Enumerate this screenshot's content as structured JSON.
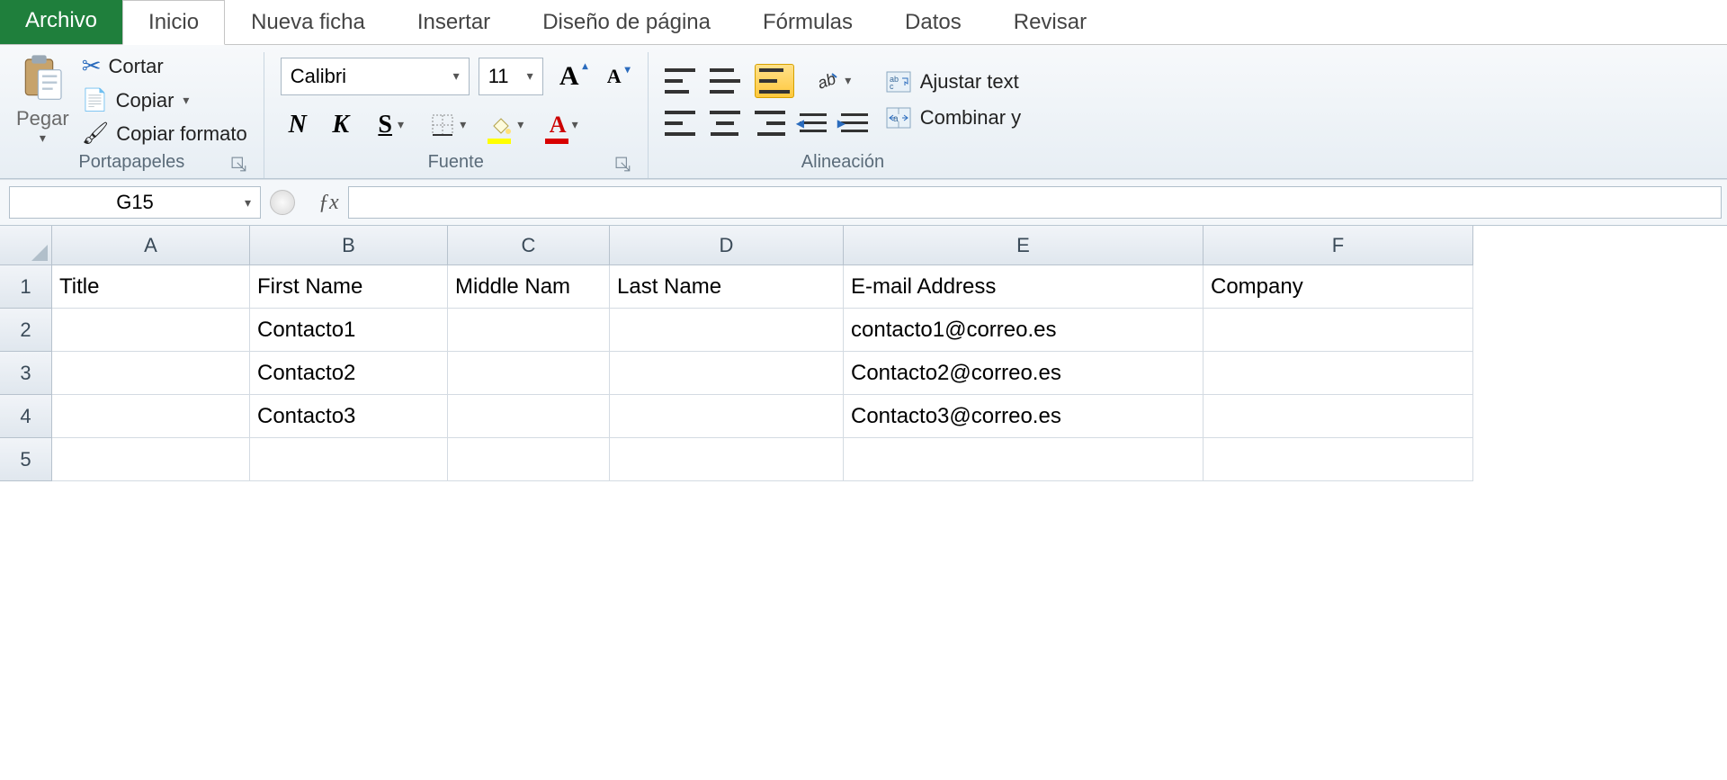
{
  "tabs": {
    "file": "Archivo",
    "home": "Inicio",
    "newsheet": "Nueva ficha",
    "insert": "Insertar",
    "pagelayout": "Diseño de página",
    "formulas": "Fórmulas",
    "data": "Datos",
    "review": "Revisar"
  },
  "clipboard": {
    "paste": "Pegar",
    "cut": "Cortar",
    "copy": "Copiar",
    "formatpainter": "Copiar formato",
    "group": "Portapapeles"
  },
  "font": {
    "name": "Calibri",
    "size": "11",
    "group": "Fuente"
  },
  "alignment": {
    "wrap": "Ajustar text",
    "merge": "Combinar y",
    "group": "Alineación"
  },
  "namebox": "G15",
  "fx": "ƒx",
  "columns": [
    "A",
    "B",
    "C",
    "D",
    "E",
    "F"
  ],
  "rows": [
    "1",
    "2",
    "3",
    "4",
    "5"
  ],
  "gridData": [
    {
      "A": "Title",
      "B": "First Name",
      "C": "Middle Nam",
      "D": "Last Name",
      "E": "E-mail Address",
      "F": "Company"
    },
    {
      "A": "",
      "B": "Contacto1",
      "C": "",
      "D": "",
      "E": "contacto1@correo.es",
      "F": ""
    },
    {
      "A": "",
      "B": "Contacto2",
      "C": "",
      "D": "",
      "E": "Contacto2@correo.es",
      "F": ""
    },
    {
      "A": "",
      "B": "Contacto3",
      "C": "",
      "D": "",
      "E": "Contacto3@correo.es",
      "F": ""
    },
    {
      "A": "",
      "B": "",
      "C": "",
      "D": "",
      "E": "",
      "F": ""
    }
  ]
}
